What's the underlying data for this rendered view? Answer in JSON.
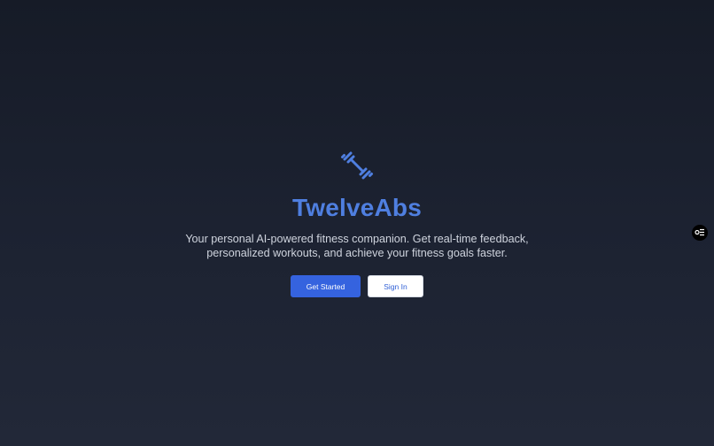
{
  "hero": {
    "title": "TwelveAbs",
    "tagline_line1": "Your personal AI-powered fitness companion. Get real-time feedback,",
    "tagline_line2": "personalized workouts, and achieve your fitness goals faster.",
    "logo_icon": "dumbbell-icon"
  },
  "actions": {
    "get_started_label": "Get Started",
    "sign_in_label": "Sign In"
  },
  "floating_widget": {
    "icon": "toggle-settings-icon"
  },
  "colors": {
    "accent": "#4f7fe0",
    "primary_button": "#3563df",
    "background_top": "#161b27",
    "background_bottom": "#222838",
    "text_muted": "#cfd4de"
  }
}
